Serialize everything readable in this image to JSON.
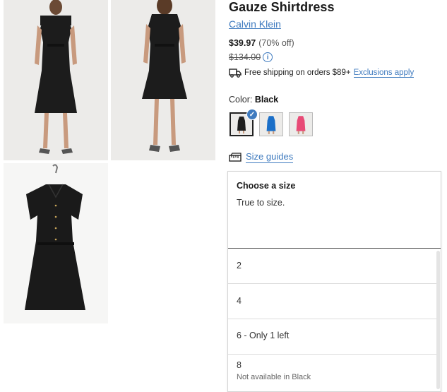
{
  "product": {
    "title": "Gauze Shirtdress",
    "brand": "Calvin Klein",
    "price_now": "$39.97",
    "price_off": "(70% off)",
    "price_was": "$134.00",
    "info_glyph": "i",
    "shipping_text": "Free shipping on orders $89+",
    "shipping_link": "Exclusions apply",
    "color_label": "Color: ",
    "color_value": "Black",
    "size_guide_label": "Size guides"
  },
  "swatches": [
    {
      "name": "black",
      "color": "#1d1d1d",
      "selected": true
    },
    {
      "name": "blue",
      "color": "#1b6fc8",
      "selected": false
    },
    {
      "name": "pink",
      "color": "#e84a76",
      "selected": false
    }
  ],
  "size_panel": {
    "heading": "Choose a size",
    "note": "True to size.",
    "options": [
      {
        "label": "2",
        "sub": ""
      },
      {
        "label": "4",
        "sub": ""
      },
      {
        "label": "6 - Only 1 left",
        "sub": ""
      },
      {
        "label": "8",
        "sub": "Not available in Black"
      }
    ]
  },
  "colors": {
    "accent": "#3f7bbf",
    "dress": "#1d1d1d"
  }
}
